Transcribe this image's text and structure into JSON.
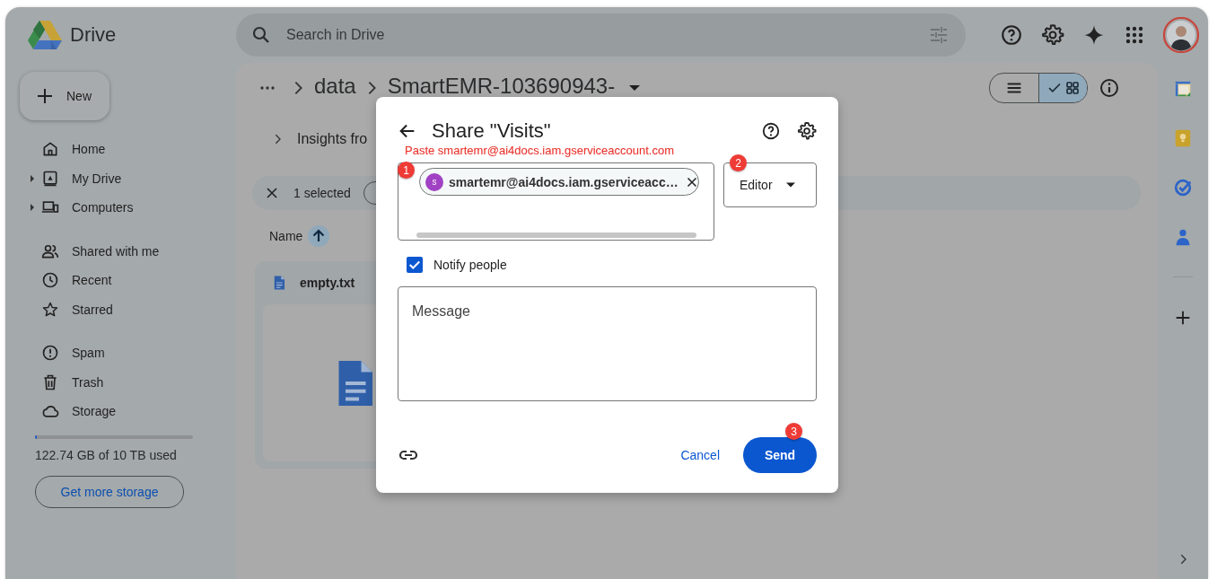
{
  "app": {
    "name": "Drive"
  },
  "search": {
    "placeholder": "Search in Drive"
  },
  "new_button": "New",
  "nav_groups": [
    [
      {
        "label": "Home",
        "has_children": false
      },
      {
        "label": "My Drive",
        "has_children": true
      },
      {
        "label": "Computers",
        "has_children": true
      }
    ],
    [
      {
        "label": "Shared with me",
        "has_children": false
      },
      {
        "label": "Recent",
        "has_children": false
      },
      {
        "label": "Starred",
        "has_children": false
      }
    ],
    [
      {
        "label": "Spam",
        "has_children": false
      },
      {
        "label": "Trash",
        "has_children": false
      },
      {
        "label": "Storage",
        "has_children": false
      }
    ]
  ],
  "storage": {
    "level": 0.012,
    "text": "122.74 GB of 10 TB used",
    "button": "Get more storage"
  },
  "breadcrumb": [
    "data",
    "SmartEMR-103690943-"
  ],
  "view_toggle": [
    {
      "selected": false
    },
    {
      "selected": true
    }
  ],
  "insights": "Insights fro",
  "selection": {
    "text": "1 selected"
  },
  "sort": {
    "label": "Name"
  },
  "files": [
    {
      "name": "empty.txt"
    }
  ],
  "dialog": {
    "title": "Share \"Visits\"",
    "annotation": "Paste smartemr@ai4docs.iam.gserviceaccount.com",
    "badges": [
      "1",
      "2",
      "3"
    ],
    "recipient": {
      "initial": "s",
      "email": "smartemr@ai4docs.iam.gserviceacc…"
    },
    "role": "Editor",
    "notify": {
      "label": "Notify people",
      "checked": true
    },
    "message": {
      "placeholder": "Message"
    },
    "cancel": "Cancel",
    "send": "Send"
  }
}
